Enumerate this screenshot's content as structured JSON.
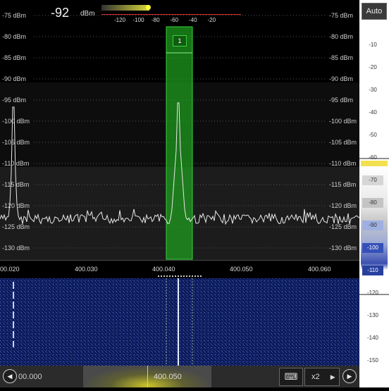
{
  "level": {
    "value": "-92",
    "unit": "dBm"
  },
  "meter": {
    "ticks": [
      "-120",
      "-100",
      "-80",
      "-60",
      "-40",
      "-20"
    ]
  },
  "spectrum": {
    "dbm_labels": [
      "-75 dBm",
      "-80 dBm",
      "-85 dBm",
      "-90 dBm",
      "-95 dBm",
      "-100 dBm",
      "-105 dBm",
      "-110 dBm",
      "-115 dBm",
      "-120 dBm",
      "-125 dBm",
      "-130 dBm"
    ],
    "freq_labels": [
      "00.020",
      "400.030",
      "400.040",
      "400.050",
      "400.060"
    ],
    "marker_label": "1"
  },
  "scale": {
    "auto_label": "Auto",
    "labels": [
      "-10",
      "-20",
      "-30",
      "-40",
      "-50",
      "-60",
      "-70",
      "-80",
      "-90",
      "-100",
      "-110",
      "-120",
      "-130",
      "-140",
      "-150"
    ]
  },
  "nav": {
    "freq_left": "00.000",
    "freq_center": "400.050",
    "zoom": "x2",
    "prev_icon": "◀",
    "next_icon": "▶",
    "keyboard_icon": "⌨",
    "zoom_arrow": "▶"
  },
  "colors": {
    "marker": "#1fa41f",
    "trace": "#e8e8e8",
    "waterfall_bg": "#0b1a5a"
  }
}
